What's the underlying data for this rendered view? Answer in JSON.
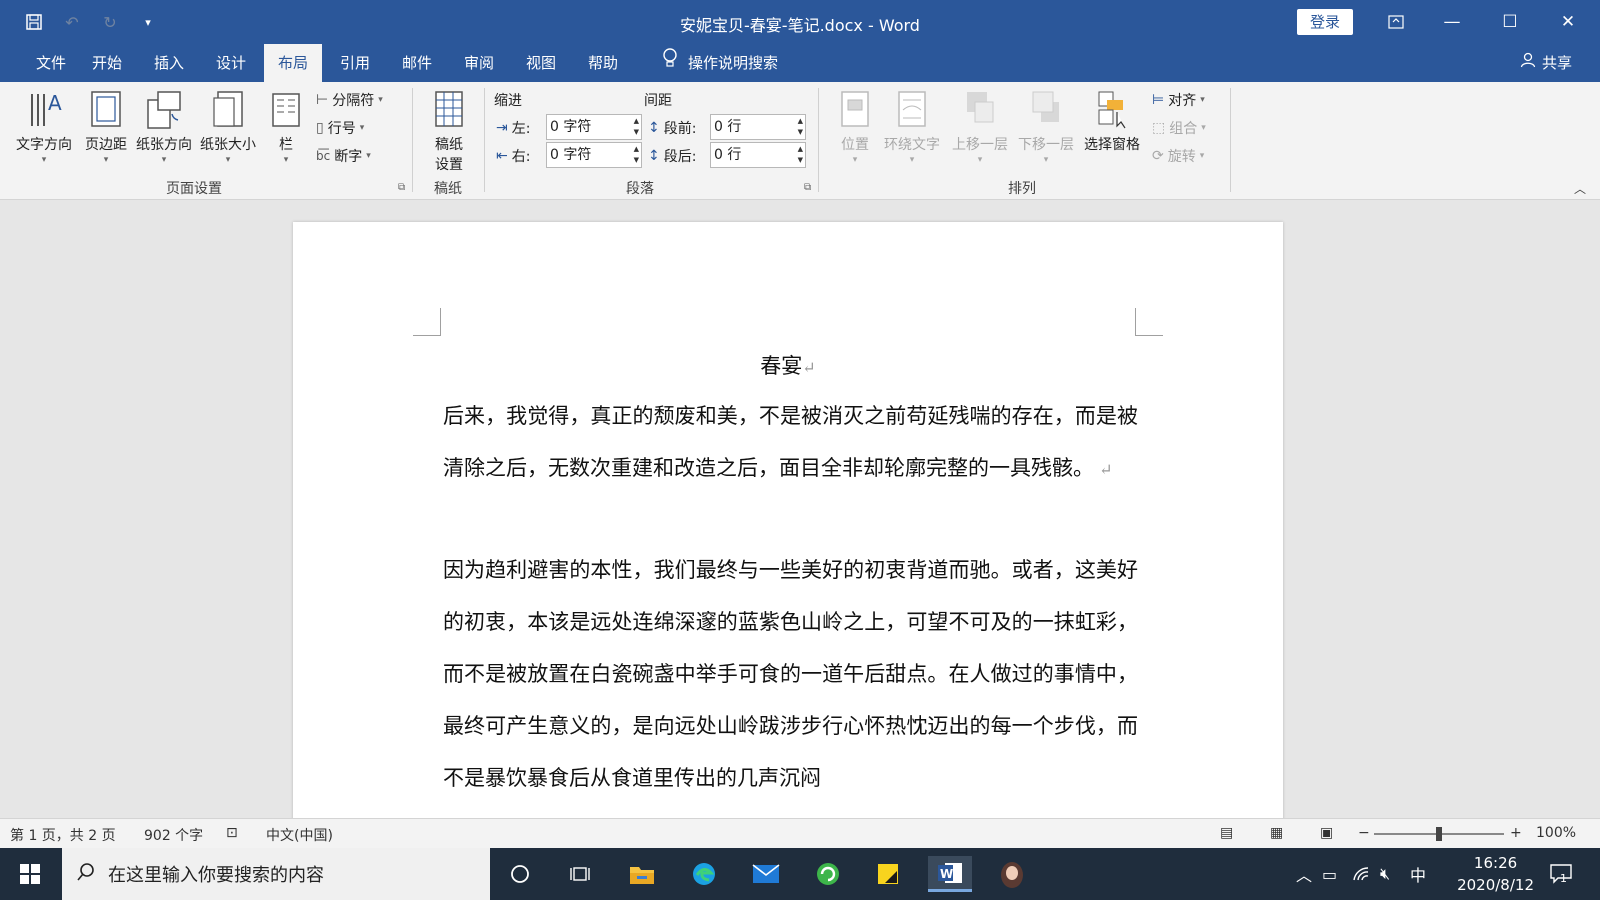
{
  "window": {
    "title": "安妮宝贝-春宴-笔记.docx  -  Word",
    "login_label": "登录",
    "share_label": "共享"
  },
  "tabs": [
    "文件",
    "开始",
    "插入",
    "设计",
    "布局",
    "引用",
    "邮件",
    "审阅",
    "视图",
    "帮助"
  ],
  "active_tab": "布局",
  "tell_me": "操作说明搜索",
  "ribbon": {
    "page_setup": {
      "text_direction": "文字方向",
      "margins": "页边距",
      "orientation": "纸张方向",
      "size": "纸张大小",
      "columns": "栏",
      "breaks": "分隔符",
      "line_numbers": "行号",
      "hyphenation": "断字",
      "group_label": "页面设置"
    },
    "draft": {
      "setup_line1": "稿纸",
      "setup_line2": "设置",
      "group_label": "稿纸"
    },
    "paragraph": {
      "indent_label": "缩进",
      "spacing_label": "间距",
      "left_label": "左:",
      "left_value": "0 字符",
      "right_label": "右:",
      "right_value": "0 字符",
      "before_label": "段前:",
      "before_value": "0 行",
      "after_label": "段后:",
      "after_value": "0 行",
      "group_label": "段落"
    },
    "arrange": {
      "position": "位置",
      "wrap_text": "环绕文字",
      "bring_forward": "上移一层",
      "send_backward": "下移一层",
      "selection_pane": "选择窗格",
      "align": "对齐",
      "group": "组合",
      "rotate": "旋转",
      "group_label": "排列"
    }
  },
  "document": {
    "heading": "春宴",
    "paragraph1": "后来，我觉得，真正的颓废和美，不是被消灭之前苟延残喘的存在，而是被清除之后，无数次重建和改造之后，面目全非却轮廓完整的一具残骸。",
    "paragraph2": "因为趋利避害的本性，我们最终与一些美好的初衷背道而驰。或者，这美好的初衷，本该是远处连绵深邃的蓝紫色山岭之上，可望不可及的一抹虹彩，而不是被放置在白瓷碗盏中举手可食的一道午后甜点。在人做过的事情中，最终可产生意义的，是向远处山岭跋涉步行心怀热忱迈出的每一个步伐，而不是暴饮暴食后从食道里传出的几声沉闷"
  },
  "statusbar": {
    "page_info": "第 1 页，共 2 页",
    "word_count": "902 个字",
    "language": "中文(中国)",
    "zoom": "100%",
    "zoom_level": 100
  },
  "taskbar": {
    "search_placeholder": "在这里输入你要搜索的内容",
    "ime": "中",
    "time": "16:26",
    "date": "2020/8/12",
    "notification_count": "1"
  },
  "colors": {
    "accent": "#2b579a",
    "ribbon_bg": "#f3f3f3",
    "doc_bg": "#e6e6e6",
    "taskbar_bg": "#1f2d3d"
  }
}
